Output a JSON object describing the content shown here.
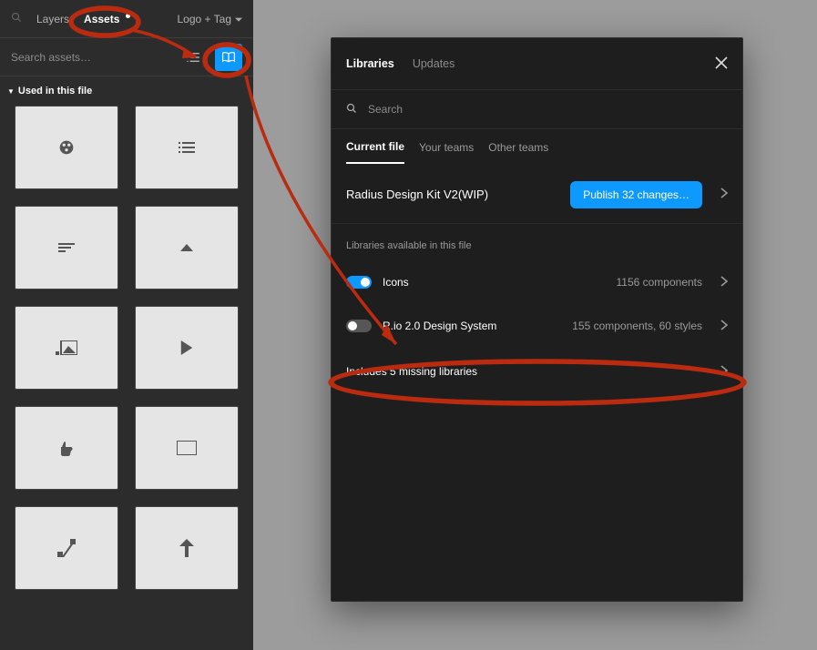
{
  "sidebar": {
    "tabs": {
      "layers": "Layers",
      "assets": "Assets"
    },
    "frame_dropdown": "Logo + Tag",
    "search_placeholder": "Search assets…",
    "section_title": "Used in this file"
  },
  "modal": {
    "tabs": {
      "libraries": "Libraries",
      "updates": "Updates"
    },
    "search_placeholder": "Search",
    "subtabs": {
      "current": "Current file",
      "your_teams": "Your teams",
      "other_teams": "Other teams"
    },
    "current_file": {
      "name": "Radius Design Kit V2(WIP)",
      "publish_label": "Publish 32 changes…"
    },
    "available_heading": "Libraries available in this file",
    "libraries": [
      {
        "name": "Icons",
        "meta": "1156 components",
        "on": true
      },
      {
        "name": "R.io 2.0 Design System",
        "meta": "155 components, 60 styles",
        "on": false
      }
    ],
    "missing": "Includes 5 missing libraries"
  }
}
